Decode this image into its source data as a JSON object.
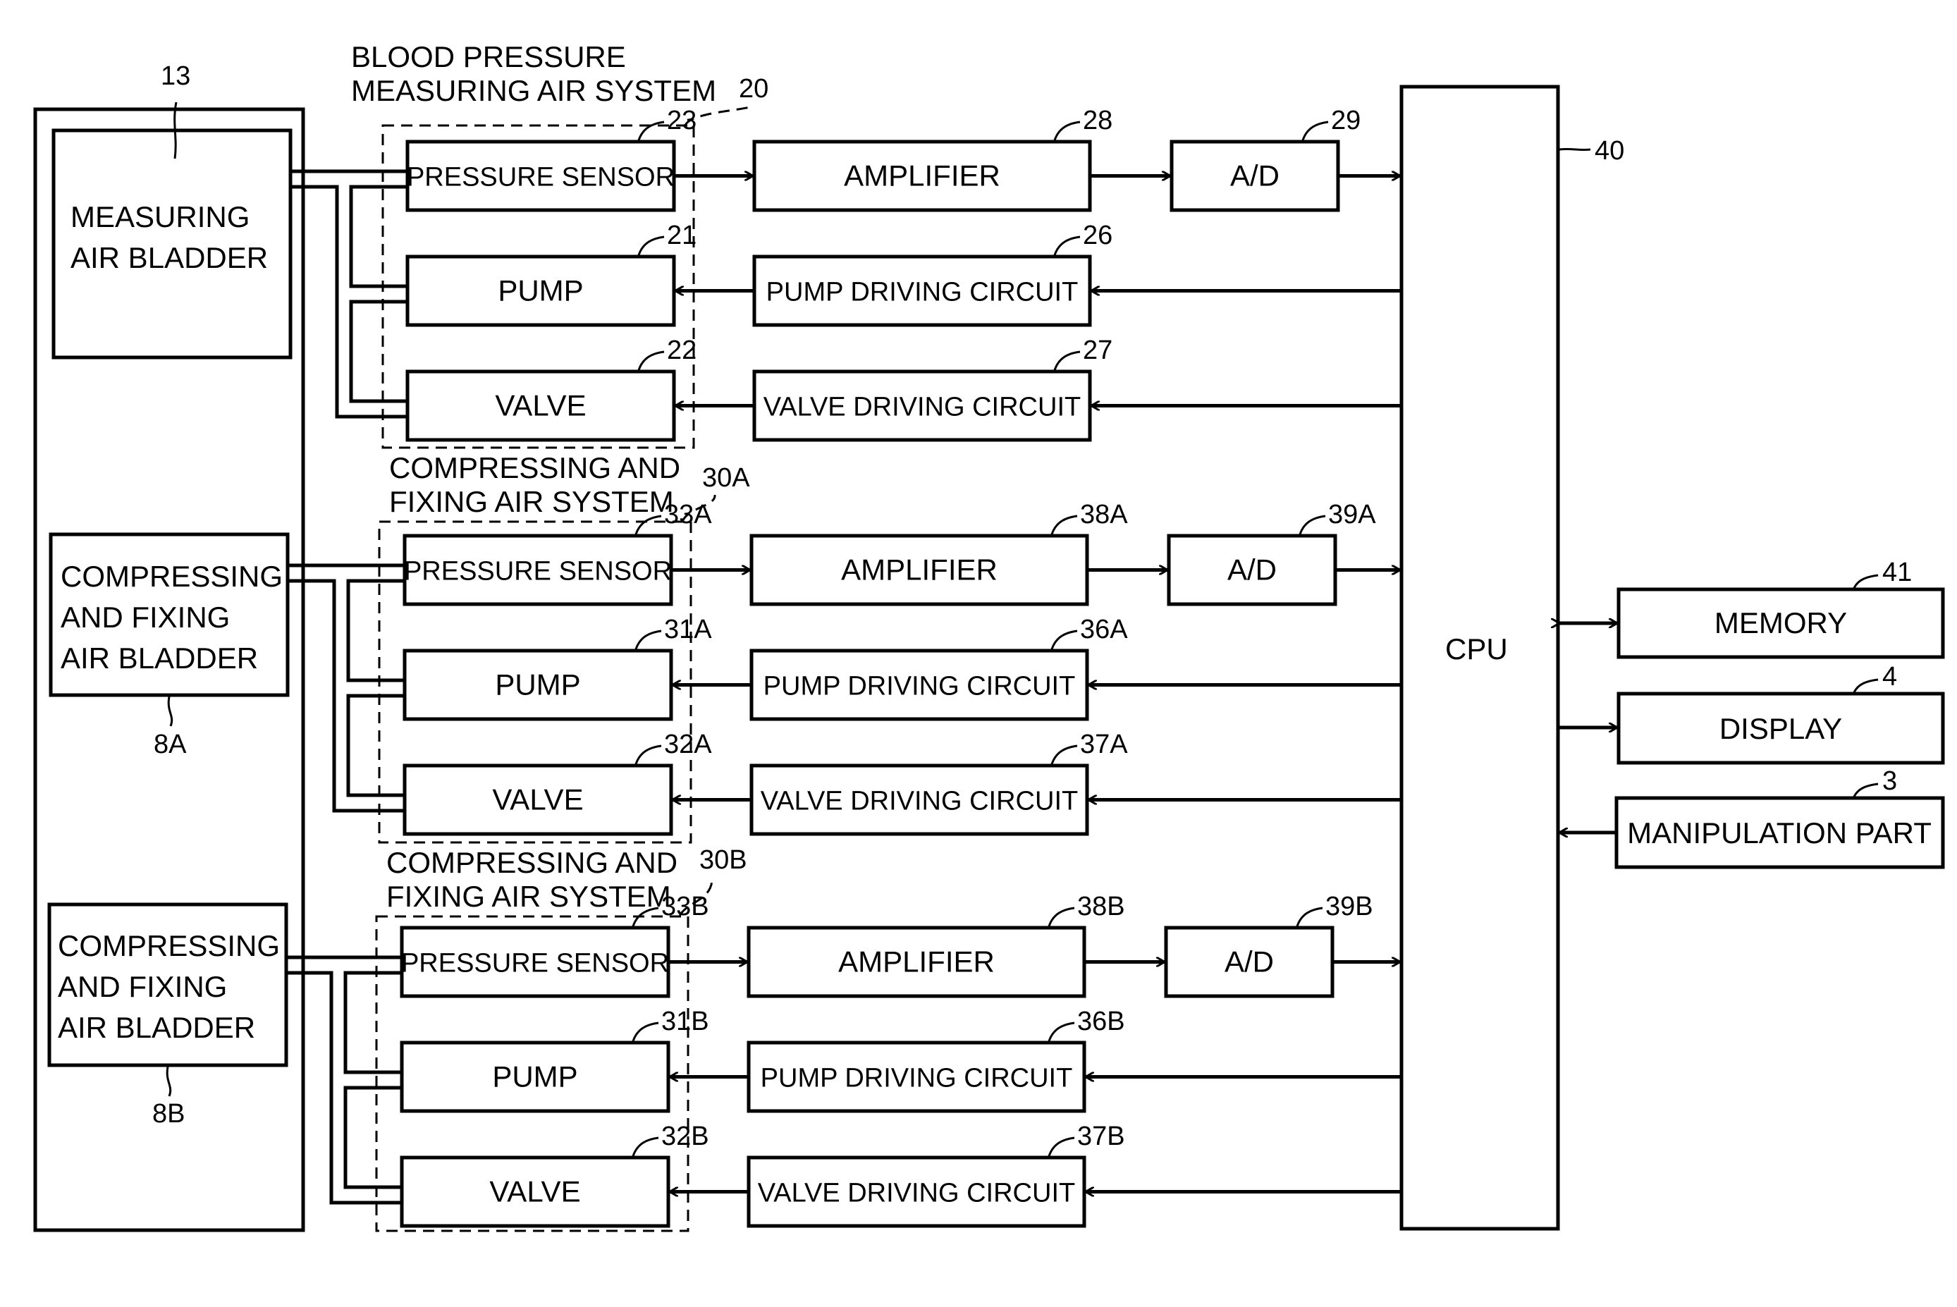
{
  "figure": {
    "cuff_body": {
      "ref": ""
    },
    "measuring_bladder": {
      "lines": [
        "MEASURING",
        "AIR BLADDER"
      ],
      "ref": "13"
    },
    "bladder_8a": {
      "lines": [
        "COMPRESSING",
        "AND FIXING",
        "AIR BLADDER"
      ],
      "ref": "8A"
    },
    "bladder_8b": {
      "lines": [
        "COMPRESSING",
        "AND FIXING",
        "AIR BLADDER"
      ],
      "ref": "8B"
    },
    "systems": [
      {
        "title_lines": [
          "BLOOD PRESSURE",
          "MEASURING AIR SYSTEM"
        ],
        "ref": "20",
        "pressure_sensor": {
          "label": "PRESSURE SENSOR",
          "ref": "23"
        },
        "pump": {
          "label": "PUMP",
          "ref": "21"
        },
        "valve": {
          "label": "VALVE",
          "ref": "22"
        },
        "amplifier": {
          "label": "AMPLIFIER",
          "ref": "28"
        },
        "ad": {
          "label": "A/D",
          "ref": "29"
        },
        "pump_driver": {
          "label": "PUMP DRIVING CIRCUIT",
          "ref": "26"
        },
        "valve_driver": {
          "label": "VALVE DRIVING CIRCUIT",
          "ref": "27"
        }
      },
      {
        "title_lines": [
          "COMPRESSING AND",
          "FIXING AIR SYSTEM"
        ],
        "ref": "30A",
        "pressure_sensor": {
          "label": "PRESSURE SENSOR",
          "ref": "33A"
        },
        "pump": {
          "label": "PUMP",
          "ref": "31A"
        },
        "valve": {
          "label": "VALVE",
          "ref": "32A"
        },
        "amplifier": {
          "label": "AMPLIFIER",
          "ref": "38A"
        },
        "ad": {
          "label": "A/D",
          "ref": "39A"
        },
        "pump_driver": {
          "label": "PUMP DRIVING CIRCUIT",
          "ref": "36A"
        },
        "valve_driver": {
          "label": "VALVE DRIVING CIRCUIT",
          "ref": "37A"
        }
      },
      {
        "title_lines": [
          "COMPRESSING AND",
          "FIXING AIR SYSTEM"
        ],
        "ref": "30B",
        "pressure_sensor": {
          "label": "PRESSURE SENSOR",
          "ref": "33B"
        },
        "pump": {
          "label": "PUMP",
          "ref": "31B"
        },
        "valve": {
          "label": "VALVE",
          "ref": "32B"
        },
        "amplifier": {
          "label": "AMPLIFIER",
          "ref": "38B"
        },
        "ad": {
          "label": "A/D",
          "ref": "39B"
        },
        "pump_driver": {
          "label": "PUMP DRIVING CIRCUIT",
          "ref": "36B"
        },
        "valve_driver": {
          "label": "VALVE DRIVING CIRCUIT",
          "ref": "37B"
        }
      }
    ],
    "cpu": {
      "label": "CPU",
      "ref": "40"
    },
    "memory": {
      "label": "MEMORY",
      "ref": "41"
    },
    "display": {
      "label": "DISPLAY",
      "ref": "4"
    },
    "manipulation": {
      "label": "MANIPULATION PART",
      "ref": "3"
    }
  }
}
